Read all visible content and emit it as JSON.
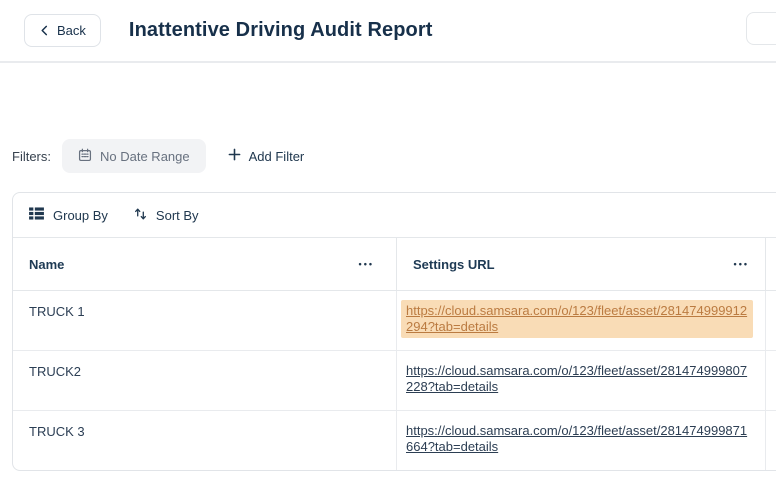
{
  "header": {
    "back_button": {
      "label": "Back",
      "icon": "chevron-left-icon"
    },
    "title": "Inattentive Driving Audit Report"
  },
  "filters": {
    "label": "Filters:",
    "date_range_button": {
      "label": "No Date Range",
      "icon": "calendar-icon"
    },
    "add_filter_button": {
      "label": "Add Filter",
      "icon": "plus-icon"
    }
  },
  "table_toolbar": {
    "group_by": {
      "label": "Group By",
      "icon": "group-by-grid-icon"
    },
    "sort_by": {
      "label": "Sort By",
      "icon": "sort-arrows-icon"
    }
  },
  "table": {
    "columns": [
      {
        "label": "Name",
        "menu_glyph": "•••"
      },
      {
        "label": "Settings URL",
        "menu_glyph": "•••"
      }
    ],
    "rows": [
      {
        "name": "TRUCK 1",
        "url": "https://cloud.samsara.com/o/123/fleet/asset/281474999912294?tab=details",
        "highlighted": true
      },
      {
        "name": "TRUCK2",
        "url": "https://cloud.samsara.com/o/123/fleet/asset/281474999807228?tab=details",
        "highlighted": false
      },
      {
        "name": "TRUCK 3",
        "url": "https://cloud.samsara.com/o/123/fleet/asset/281474999871664?tab=details",
        "highlighted": false
      }
    ]
  },
  "colors": {
    "title_navy": "#17304a",
    "body_navy": "#2b3e54",
    "muted_gray": "#68717f",
    "border_gray": "#e4e7ea",
    "highlight_background": "#f9dcb6",
    "highlight_text": "#bb7b41"
  }
}
